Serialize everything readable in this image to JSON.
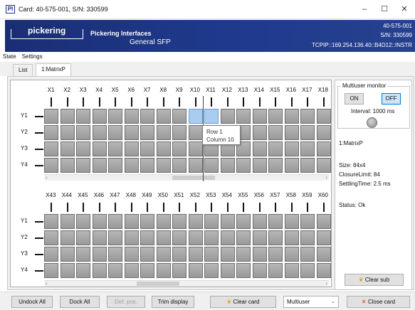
{
  "window": {
    "title": "Card: 40-575-001, S/N: 330599",
    "minimize_glyph": "–",
    "maximize_glyph": "☐",
    "close_glyph": "✕"
  },
  "banner": {
    "logo_text": "pickering",
    "company": "Pickering Interfaces",
    "product": "General SFP",
    "card_id": "40-575-001",
    "serial": "S/N: 330599",
    "address": "TCPIP::169.254.136.40::B4D12::INSTR"
  },
  "menu": [
    "State",
    "Settings"
  ],
  "tabs": [
    {
      "label": "List"
    },
    {
      "label": "1:MatrixP"
    }
  ],
  "matrix": {
    "rows": [
      "Y1",
      "Y2",
      "Y3",
      "Y4"
    ],
    "upper_columns": [
      "X1",
      "X2",
      "X3",
      "X4",
      "X5",
      "X6",
      "X7",
      "X8",
      "X9",
      "X10",
      "X11",
      "X12",
      "X13",
      "X14",
      "X15",
      "X16",
      "X17",
      "X18"
    ],
    "lower_columns": [
      "X43",
      "X44",
      "X45",
      "X46",
      "X47",
      "X48",
      "X49",
      "X50",
      "X51",
      "X52",
      "X53",
      "X54",
      "X55",
      "X56",
      "X57",
      "X58",
      "X59",
      "X60"
    ],
    "tooltip": {
      "row": "Row 1",
      "column": "Column 10"
    }
  },
  "multiuser": {
    "title": "Multiuser monitor",
    "on_label": "ON",
    "off_label": "OFF",
    "interval": "Interval: 1000 ms"
  },
  "info": {
    "name": "1:MatrixP",
    "size": "Size: 84x4",
    "closure_limit": "ClosureLimit: 84",
    "settling_time": "SettlingTime: 2.5 ms",
    "status": "Status: Ok"
  },
  "clear_sub_label": "Clear sub",
  "bottom": {
    "undock_all": "Undock All",
    "dock_all": "Dock All",
    "def_pos": "Def. pos.",
    "trim_display": "Trim display",
    "clear_card": "Clear card",
    "mode_select": "Multiuser",
    "close_card": "Close card"
  },
  "colors": {
    "banner": "#1a2e74",
    "cell": "#a6a6a6",
    "cell_hot": "#a8cdf0",
    "toggle_active": "#cce4f7"
  },
  "icons": {
    "app": "pickering-logo-icon",
    "broom": "broom-icon",
    "close_x": "red-x-icon",
    "dropdown": "chevron-down-icon"
  }
}
